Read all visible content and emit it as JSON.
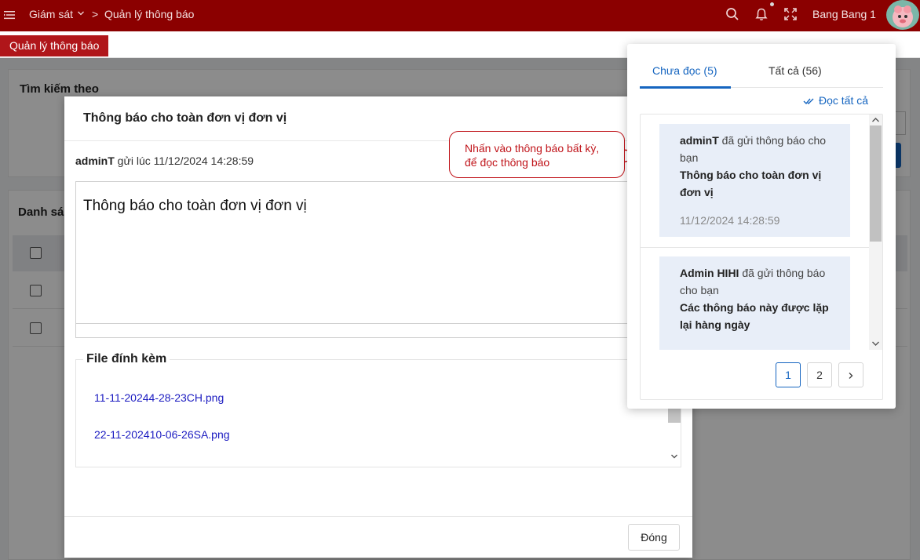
{
  "topbar": {
    "breadcrumb_1": "Giám sát",
    "breadcrumb_sep": ">",
    "breadcrumb_2": "Quản lý thông báo",
    "user_name": "Bang Bang 1",
    "icons": [
      "menu-icon",
      "search-icon",
      "bell-icon",
      "fullscreen-icon"
    ]
  },
  "tabstrip": {
    "active_tab": "Quản lý thông báo"
  },
  "background": {
    "search_title": "Tìm kiếm theo",
    "list_title": "Danh sá"
  },
  "modal": {
    "title": "Thông báo cho toàn đơn vị đơn vị",
    "sender": "adminT",
    "sent_label": "gửi lúc",
    "sent_time": "11/12/2024 14:28:59",
    "content": "Thông báo cho toàn đơn vị đơn vị",
    "attachments_title": "File đính kèm",
    "attachments": [
      "11-11-20244-28-23CH.png",
      "22-11-202410-06-26SA.png"
    ],
    "close_label": "Đóng"
  },
  "callout": {
    "text": "Nhấn vào thông báo bất kỳ, để đọc thông báo"
  },
  "notifications": {
    "tab_unread": "Chưa đọc (5)",
    "tab_all": "Tất cả (56)",
    "read_all": "Đọc tất cả",
    "items": [
      {
        "sender": "adminT",
        "action": "đã gửi thông báo cho bạn",
        "title": "Thông báo cho toàn đơn vị đơn vị",
        "time": "11/12/2024 14:28:59"
      },
      {
        "sender": "Admin HIHI",
        "action": "đã gửi thông báo cho bạn",
        "title": "Các thông báo này được lặp lại hàng ngày",
        "time": ""
      }
    ],
    "pages": [
      "1",
      "2"
    ],
    "current_page": "1"
  },
  "colors": {
    "topbar": "#8b0000",
    "tab_active": "#b0161a",
    "accent_blue": "#1565c0",
    "callout_red": "#c0141a",
    "notif_bg": "#e8eef8"
  }
}
